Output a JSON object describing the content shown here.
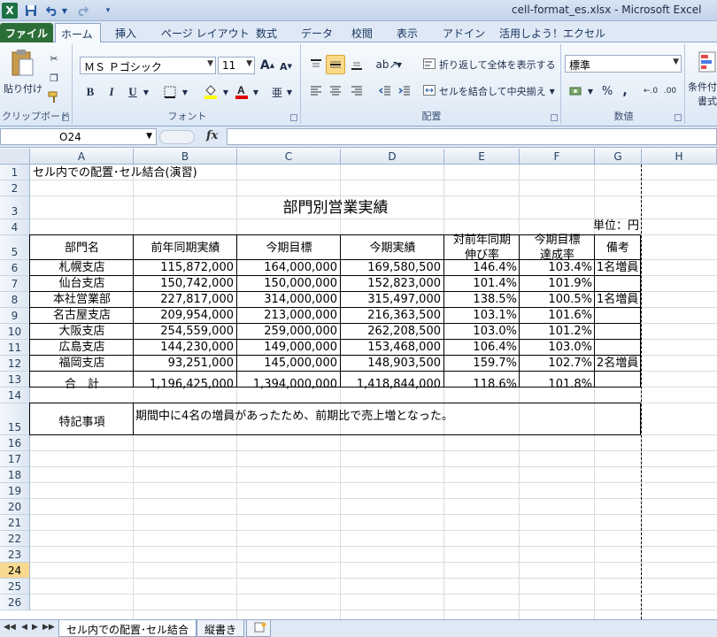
{
  "window": {
    "title": "cell-format_es.xlsx  -  Microsoft Excel"
  },
  "qat": {
    "excel_logo": "excel-logo-icon",
    "save": "save-icon",
    "undo": "undo-icon",
    "redo": "redo-icon",
    "customize": "customize-icon"
  },
  "ribbon_tabs": [
    "ファイル",
    "ホーム",
    "挿入",
    "ページ レイアウト",
    "数式",
    "データ",
    "校閲",
    "表示",
    "アドイン",
    "活用しよう！エクセル"
  ],
  "ribbon": {
    "clipboard": {
      "paste": "貼り付け",
      "group": "クリップボード"
    },
    "font": {
      "name": "ＭＳ Ｐゴシック",
      "size": "11",
      "group": "フォント",
      "bold": "B",
      "italic": "I",
      "underline": "U",
      "grow": "A",
      "shrink": "A"
    },
    "alignment": {
      "wrap": "折り返して全体を表示する",
      "merge": "セルを結合して中央揃え",
      "group": "配置"
    },
    "number": {
      "format": "標準",
      "percent": "%",
      "comma": ",",
      "group": "数値",
      "inc": "←.0",
      "dec": ".00"
    },
    "styles": {
      "conditional": "条件付き",
      "conditional2": "書式"
    }
  },
  "formula_bar": {
    "name_box": "O24",
    "fx": "fx",
    "value": ""
  },
  "columns": [
    "A",
    "B",
    "C",
    "D",
    "E",
    "F",
    "G",
    "H"
  ],
  "rows": [
    "1",
    "2",
    "3",
    "4",
    "5",
    "6",
    "7",
    "8",
    "9",
    "10",
    "11",
    "12",
    "13",
    "14",
    "15",
    "16",
    "17",
    "18",
    "19",
    "20",
    "21",
    "22",
    "23",
    "24",
    "25",
    "26"
  ],
  "selected_row": "24",
  "sheet": {
    "a1": "セル内での配置･セル結合(演習)",
    "title": "部門別営業実績",
    "unit": "単位：円",
    "headers": {
      "dept": "部門名",
      "prev": "前年同期実績",
      "target": "今期目標",
      "actual": "今期実績",
      "yoy1": "対前年同期",
      "yoy2": "伸び率",
      "ach1": "今期目標",
      "ach2": "達成率",
      "note": "備考"
    },
    "data": [
      {
        "dept": "札幌支店",
        "prev": "115,872,000",
        "target": "164,000,000",
        "actual": "169,580,500",
        "yoy": "146.4%",
        "ach": "103.4%",
        "note": "1名増員"
      },
      {
        "dept": "仙台支店",
        "prev": "150,742,000",
        "target": "150,000,000",
        "actual": "152,823,000",
        "yoy": "101.4%",
        "ach": "101.9%",
        "note": ""
      },
      {
        "dept": "本社営業部",
        "prev": "227,817,000",
        "target": "314,000,000",
        "actual": "315,497,000",
        "yoy": "138.5%",
        "ach": "100.5%",
        "note": "1名増員"
      },
      {
        "dept": "名古屋支店",
        "prev": "209,954,000",
        "target": "213,000,000",
        "actual": "216,363,500",
        "yoy": "103.1%",
        "ach": "101.6%",
        "note": ""
      },
      {
        "dept": "大阪支店",
        "prev": "254,559,000",
        "target": "259,000,000",
        "actual": "262,208,500",
        "yoy": "103.0%",
        "ach": "101.2%",
        "note": ""
      },
      {
        "dept": "広島支店",
        "prev": "144,230,000",
        "target": "149,000,000",
        "actual": "153,468,000",
        "yoy": "106.4%",
        "ach": "103.0%",
        "note": ""
      },
      {
        "dept": "福岡支店",
        "prev": "93,251,000",
        "target": "145,000,000",
        "actual": "148,903,500",
        "yoy": "159.7%",
        "ach": "102.7%",
        "note": "2名増員"
      }
    ],
    "total": {
      "dept": "合　計",
      "prev": "1,196,425,000",
      "target": "1,394,000,000",
      "actual": "1,418,844,000",
      "yoy": "118.6%",
      "ach": "101.8%"
    },
    "remarks_label": "特記事項",
    "remarks_text": "期間中に4名の増員があったため、前期比で売上増となった。"
  },
  "sheet_tabs": [
    "セル内での配置･セル結合",
    "縦書き"
  ],
  "new_sheet_icon": "insert-sheet-icon"
}
